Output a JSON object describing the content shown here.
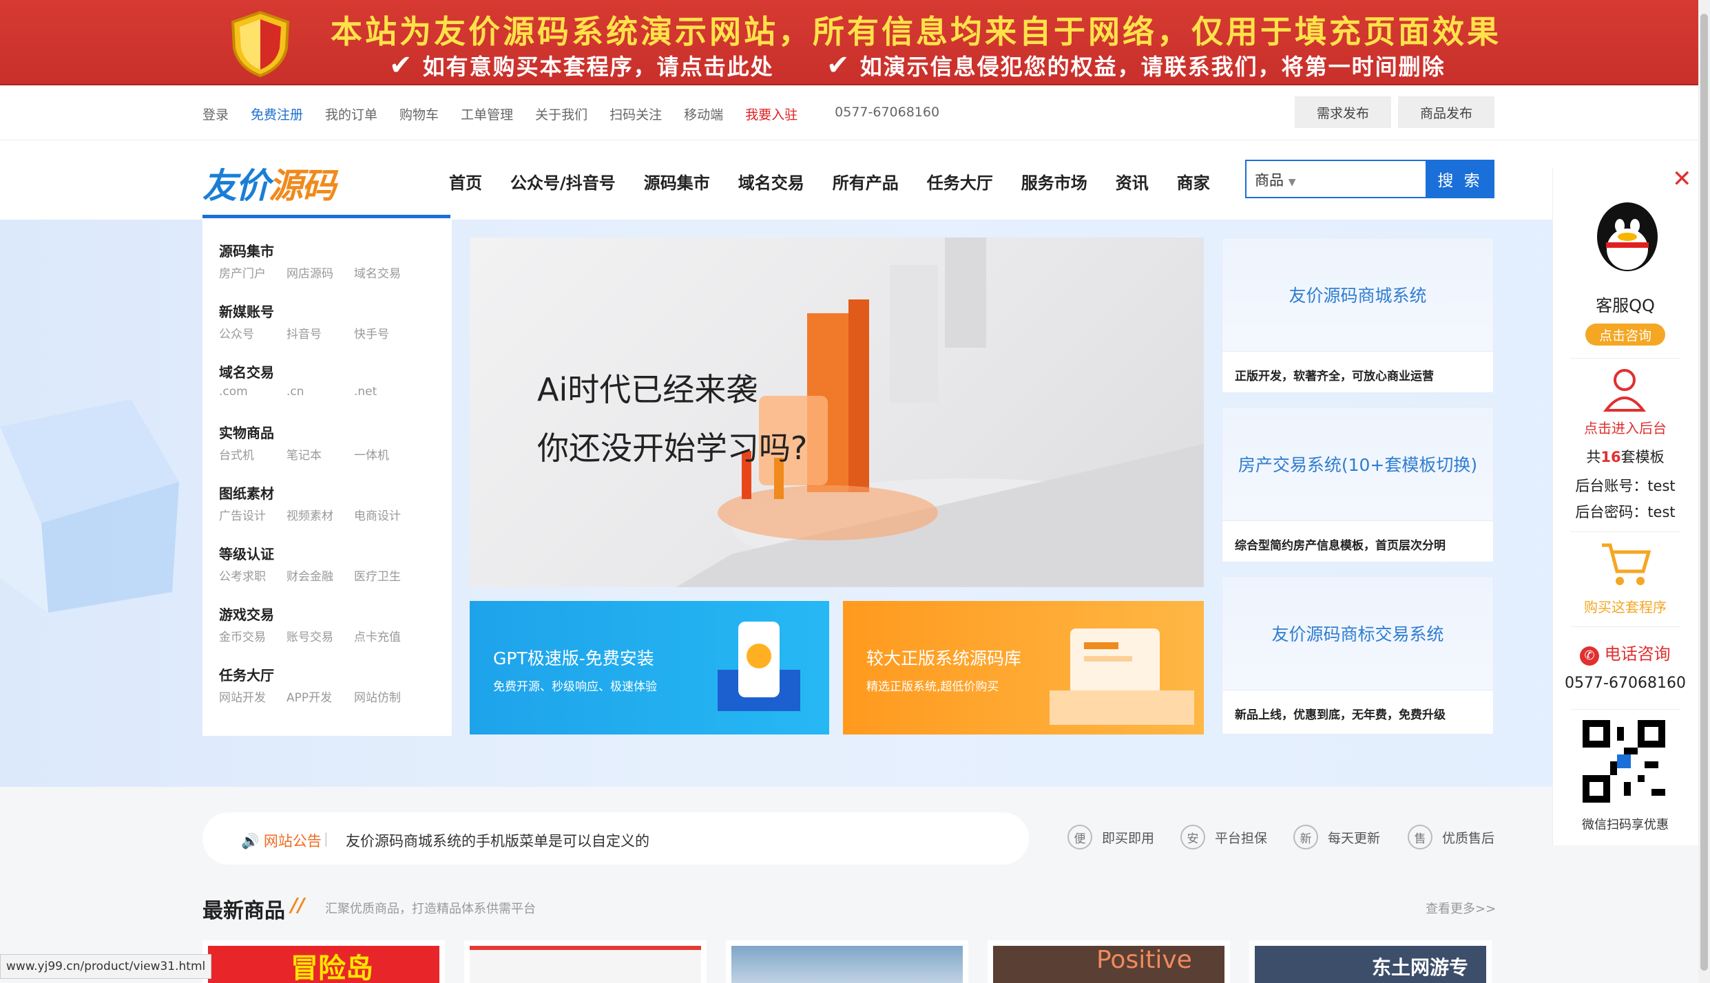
{
  "banner": {
    "headline": "本站为友价源码系统演示网站，所有信息均来自于网络，仅用于填充页面效果",
    "note_left": "如有意购买本套程序，请点击此处",
    "note_right": "如演示信息侵犯您的权益，请联系我们，将第一时间删除"
  },
  "topbar": {
    "links": [
      "登录",
      "免费注册",
      "我的订单",
      "购物车",
      "工单管理",
      "关于我们",
      "扫码关注",
      "移动端",
      "我要入驻"
    ],
    "phone": "0577-67068160",
    "btn_demand": "需求发布",
    "btn_goods": "商品发布"
  },
  "header": {
    "logo_a": "友价",
    "logo_b": "源码",
    "nav": [
      "首页",
      "公众号/抖音号",
      "源码集市",
      "域名交易",
      "所有产品",
      "任务大厅",
      "服务市场",
      "资讯",
      "商家"
    ],
    "search_select": "商品",
    "search_button": "搜 索"
  },
  "categories": [
    {
      "title": "源码集市",
      "subs": [
        "房产门户",
        "网店源码",
        "域名交易"
      ]
    },
    {
      "title": "新媒账号",
      "subs": [
        "公众号",
        "抖音号",
        "快手号"
      ]
    },
    {
      "title": "域名交易",
      "subs": [
        ".com",
        ".cn",
        ".net"
      ]
    },
    {
      "title": "实物商品",
      "subs": [
        "台式机",
        "笔记本",
        "一体机"
      ]
    },
    {
      "title": "图纸素材",
      "subs": [
        "广告设计",
        "视频素材",
        "电商设计"
      ]
    },
    {
      "title": "等级认证",
      "subs": [
        "公考求职",
        "财会金融",
        "医疗卫生"
      ]
    },
    {
      "title": "游戏交易",
      "subs": [
        "金币交易",
        "账号交易",
        "点卡充值"
      ]
    },
    {
      "title": "任务大厅",
      "subs": [
        "网站开发",
        "APP开发",
        "网站仿制"
      ]
    }
  ],
  "main_banner": {
    "line1": "Ai时代已经来袭",
    "line2": "你还没开始学习吗?"
  },
  "small_banners": [
    {
      "title": "GPT极速版-免费安装",
      "sub": "免费开源、秒级响应、极速体验"
    },
    {
      "title": "较大正版系统源码库",
      "sub": "精选正版系统,超低价购买"
    }
  ],
  "right_cards": [
    {
      "title": "友价源码商城系统",
      "sub": "正版开发，软著齐全，可放心商业运营"
    },
    {
      "title": "房产交易系统(10+套模板切换)",
      "sub": "综合型简约房产信息模板，首页层次分明"
    },
    {
      "title": "友价源码商标交易系统",
      "sub": "新品上线，优惠到底，无年费，免费升级"
    }
  ],
  "float_panel": {
    "qq_label": "客服QQ",
    "consult": "点击咨询",
    "admin_label": "点击进入后台",
    "templates_prefix": "共",
    "templates_count": "16",
    "templates_suffix": "套模板",
    "account": "后台账号：test",
    "password": "后台密码：test",
    "buy": "购买这套程序",
    "call": "电话咨询",
    "phone": "0577-67068160",
    "qr_text": "微信扫码享优惠"
  },
  "notice": {
    "label": "网站公告",
    "text": "友价源码商城系统的手机版菜单是可以自定义的"
  },
  "features": [
    {
      "icon": "便",
      "label": "即买即用"
    },
    {
      "icon": "安",
      "label": "平台担保"
    },
    {
      "icon": "新",
      "label": "每天更新"
    },
    {
      "icon": "售",
      "label": "优质售后"
    }
  ],
  "latest": {
    "title": "最新商品",
    "slash": "//",
    "subtitle": "汇聚优质商品，打造精品体系供需平台",
    "more": "查看更多>>"
  },
  "product_thumbs": [
    {
      "text": "冒险岛",
      "bg": "#e8262a"
    },
    {
      "text": "",
      "bg": "#f5f5f5"
    },
    {
      "text": "",
      "bg": "#7fa6c8"
    },
    {
      "text": "Positive",
      "bg": "#5a3f34"
    },
    {
      "text": "东土网游专营店",
      "bg": "#3c4e6a"
    }
  ],
  "status_url": "www.yj99.cn/product/view31.html",
  "colors": {
    "brand": "#1a6fd8",
    "accent": "#f08a1d",
    "banner_red": "#c9302b"
  }
}
